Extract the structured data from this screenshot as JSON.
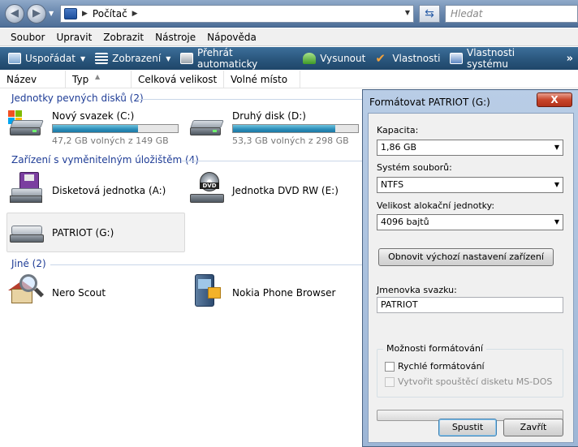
{
  "address": {
    "crumb": "Počítač",
    "search_placeholder": "Hledat"
  },
  "menu": [
    "Soubor",
    "Upravit",
    "Zobrazit",
    "Nástroje",
    "Nápověda"
  ],
  "toolbar": {
    "organize": "Uspořádat",
    "views": "Zobrazení",
    "autoplay": "Přehrát automaticky",
    "eject": "Vysunout",
    "properties": "Vlastnosti",
    "system_properties": "Vlastnosti systému",
    "more": "»"
  },
  "columns": [
    "Název",
    "Typ",
    "Celková velikost",
    "Volné místo"
  ],
  "groups": {
    "hard_disks": "Jednotky pevných disků (2)",
    "removable": "Zařízení s vyměnitelným úložištěm (4)",
    "other": "Jiné (2)"
  },
  "drives": {
    "c": {
      "name": "Nový svazek (C:)",
      "free": "47,2 GB volných z 149 GB",
      "used_fraction": 0.68
    },
    "d": {
      "name": "Druhý disk (D:)",
      "free": "53,3 GB volných z 298 GB",
      "used_fraction": 0.82
    }
  },
  "removable": {
    "floppy": "Disketová jednotka (A:)",
    "dvd": "Jednotka DVD RW (E:)",
    "dvd_badge": "DVD",
    "patriot": "PATRIOT (G:)"
  },
  "other": {
    "nero": "Nero Scout",
    "nokia": "Nokia Phone Browser"
  },
  "dialog": {
    "title": "Formátovat PATRIOT (G:)",
    "close": "X",
    "capacity_label": "Kapacita:",
    "capacity_value": "1,86 GB",
    "fs_label": "Systém souborů:",
    "fs_value": "NTFS",
    "alloc_label": "Velikost alokační jednotky:",
    "alloc_value": "4096 bajtů",
    "restore_button": "Obnovit výchozí nastavení zařízení",
    "volume_label": "Jmenovka svazku:",
    "volume_value": "PATRIOT",
    "options_legend": "Možnosti formátování",
    "quick_format": "Rychlé formátování",
    "msdos_disk": "Vytvořit spouštěcí disketu MS-DOS",
    "start_button": "Spustit",
    "close_button": "Zavřít",
    "progress": 0
  }
}
